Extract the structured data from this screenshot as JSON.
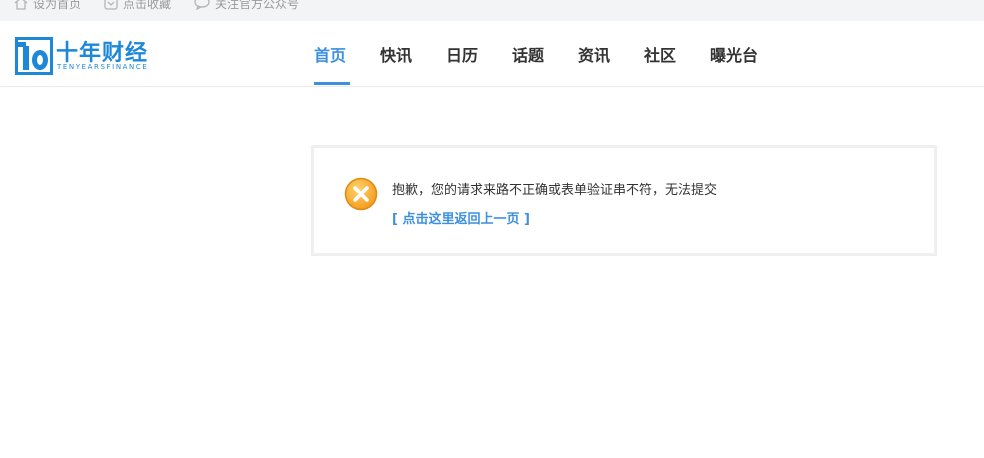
{
  "topbar": {
    "home_label": "设为首页",
    "fav_label": "点击收藏",
    "wechat_label": "关注官方公众号"
  },
  "logo": {
    "cn": "十年财经",
    "en": "TENYEARSFINANCE"
  },
  "nav": {
    "items": [
      {
        "label": "首页",
        "active": true
      },
      {
        "label": "快讯"
      },
      {
        "label": "日历"
      },
      {
        "label": "话题"
      },
      {
        "label": "资讯"
      },
      {
        "label": "社区"
      },
      {
        "label": "曝光台"
      }
    ]
  },
  "message": {
    "text": "抱歉，您的请求来路不正确或表单验证串不符，无法提交",
    "back_link": "[ 点击这里返回上一页 ]"
  },
  "colors": {
    "accent": "#3d8fe0",
    "logo_blue": "#1e88d8",
    "error_orange": "#f5a623"
  }
}
